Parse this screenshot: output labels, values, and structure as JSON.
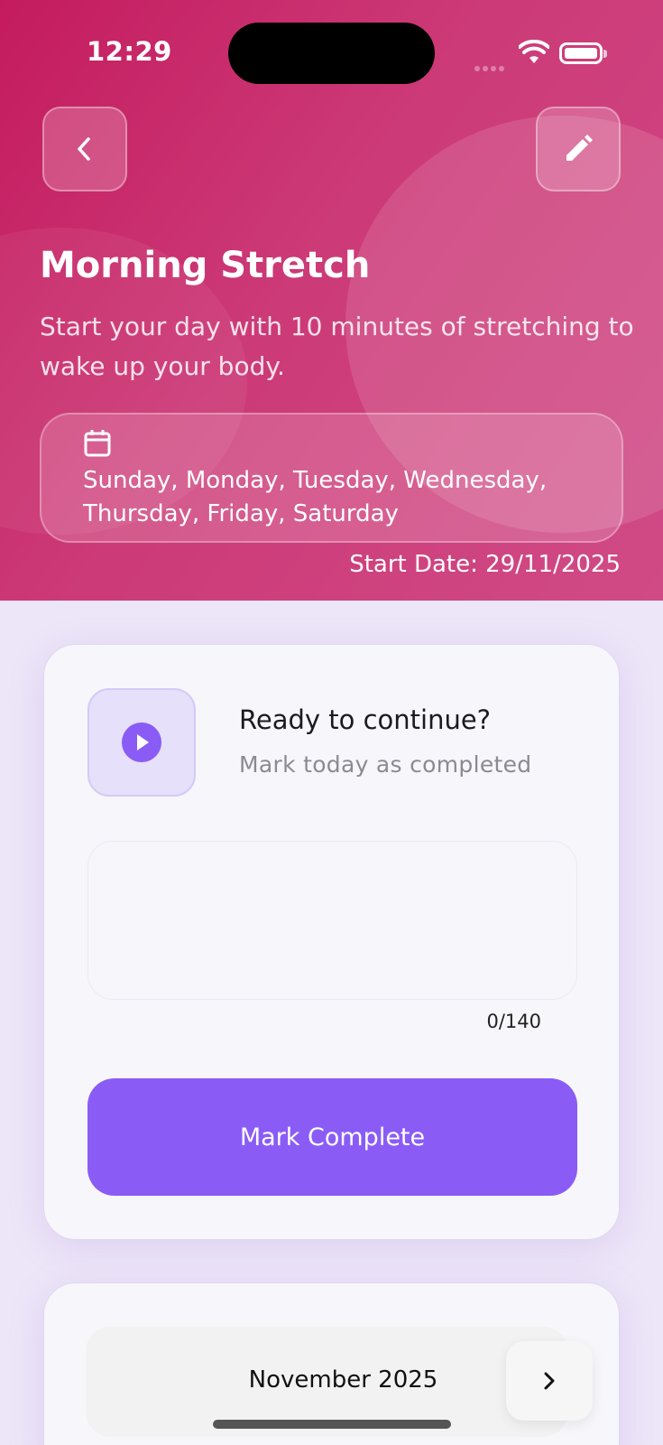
{
  "status_bar": {
    "time": "12:29"
  },
  "header": {
    "back_icon": "chevron-left-icon",
    "edit_icon": "pencil-icon",
    "title": "Morning Stretch",
    "description": "Start your day with 10 minutes of stretching to wake up your body.",
    "schedule_icon": "calendar-icon",
    "schedule_days": "Sunday, Monday, Tuesday, Wednesday, Thursday, Friday, Saturday",
    "start_date": "Start Date: 29/11/2025"
  },
  "checkin_card": {
    "icon": "play-circle-icon",
    "title": "Ready to continue?",
    "subtitle": "Mark today as completed",
    "note_value": "",
    "char_counter": "0/140",
    "button_label": "Mark Complete"
  },
  "calendar_card": {
    "month_label": "November 2025",
    "next_icon": "chevron-right-icon"
  },
  "colors": {
    "header_gradient_start": "#c41b5e",
    "header_gradient_end": "#d04a86",
    "accent": "#8a5cf5",
    "background": "#ede6f8",
    "card": "#f7f6fb"
  }
}
